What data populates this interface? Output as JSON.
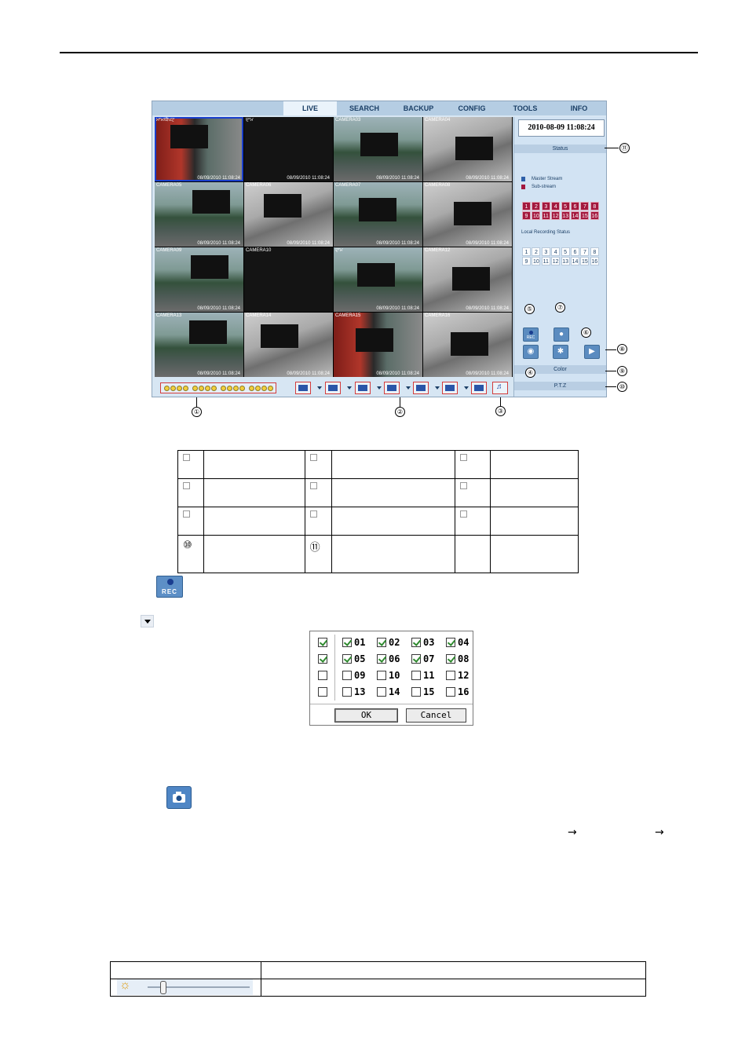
{
  "menu": {
    "tabs": [
      "LIVE",
      "SEARCH",
      "BACKUP",
      "CONFIG",
      "TOOLS",
      "INFO"
    ],
    "active": "LIVE"
  },
  "cameras": [
    {
      "label": "ਮਾਮ/ਕੈਪਟ",
      "ts": "08/09/2010 11:08:24",
      "scene": "street-red",
      "selected": true
    },
    {
      "label": "ਦਾਮ",
      "ts": "08/09/2010 11:08:24",
      "scene": "dark"
    },
    {
      "label": "CAMERA03",
      "ts": "08/09/2010 11:08:24",
      "scene": "street"
    },
    {
      "label": "CAMERA04",
      "ts": "08/09/2010 11:08:24",
      "scene": "parking"
    },
    {
      "label": "CAMERA05",
      "ts": "08/09/2010 11:08:24",
      "scene": "street"
    },
    {
      "label": "CAMERA06",
      "ts": "08/09/2010 11:08:24",
      "scene": "parking"
    },
    {
      "label": "CAMERA07",
      "ts": "08/09/2010 11:08:24",
      "scene": "street"
    },
    {
      "label": "CAMERA08",
      "ts": "08/09/2010 11:08:24",
      "scene": "parking"
    },
    {
      "label": "CAMERA09",
      "ts": "08/09/2010 11:08:24",
      "scene": "street"
    },
    {
      "label": "CAMERA10",
      "ts": "",
      "scene": "dark"
    },
    {
      "label": "ਦਾਮ",
      "ts": "08/09/2010 11:08:24",
      "scene": "street"
    },
    {
      "label": "CAMERA12",
      "ts": "08/09/2010 11:08:24",
      "scene": "parking"
    },
    {
      "label": "CAMERA13",
      "ts": "08/09/2010 11:08:24",
      "scene": "street"
    },
    {
      "label": "CAMERA14",
      "ts": "08/09/2010 11:08:24",
      "scene": "parking"
    },
    {
      "label": "CAMERA15",
      "ts": "08/09/2010 11:08:24",
      "scene": "street-red"
    },
    {
      "label": "CAMERA16",
      "ts": "08/09/2010 11:08:24",
      "scene": "parking"
    }
  ],
  "panel": {
    "datetime": "2010-08-09 11:08:24",
    "status_label": "Status",
    "master_stream": "Master Stream",
    "sub_stream": "Sub-stream",
    "channels_row1": [
      "1",
      "2",
      "3",
      "4",
      "5",
      "6",
      "7",
      "8"
    ],
    "channels_row2": [
      "9",
      "10",
      "11",
      "12",
      "13",
      "14",
      "15",
      "16"
    ],
    "local_rec_label": "Local Recording Status",
    "color_label": "Color",
    "ptz_label": "P.T.Z",
    "rec_btn": "REC",
    "colors": {
      "master": "#2e5fa8",
      "sub": "#a3183e"
    }
  },
  "callouts": {
    "c1": "①",
    "c2": "②",
    "c3": "③",
    "c4": "④",
    "c5": "⑤",
    "c6": "⑥",
    "c7": "⑦",
    "c8": "⑧",
    "c9": "⑨",
    "c10": "⑩",
    "c11": "⑪"
  },
  "legend_table": {
    "row4_c1": "⑩",
    "row4_c2": "⑪"
  },
  "rec_icon_label": "REC",
  "dialog": {
    "rows": [
      {
        "all": true,
        "items": [
          {
            "n": "01",
            "on": true
          },
          {
            "n": "02",
            "on": true
          },
          {
            "n": "03",
            "on": true
          },
          {
            "n": "04",
            "on": true
          }
        ]
      },
      {
        "all": true,
        "items": [
          {
            "n": "05",
            "on": true
          },
          {
            "n": "06",
            "on": true
          },
          {
            "n": "07",
            "on": true
          },
          {
            "n": "08",
            "on": true
          }
        ]
      },
      {
        "all": false,
        "items": [
          {
            "n": "09",
            "on": false
          },
          {
            "n": "10",
            "on": false
          },
          {
            "n": "11",
            "on": false
          },
          {
            "n": "12",
            "on": false
          }
        ]
      },
      {
        "all": false,
        "items": [
          {
            "n": "13",
            "on": false
          },
          {
            "n": "14",
            "on": false
          },
          {
            "n": "15",
            "on": false
          },
          {
            "n": "16",
            "on": false
          }
        ]
      }
    ],
    "ok": "OK",
    "cancel": "Cancel"
  },
  "arrows": [
    "",
    ""
  ]
}
